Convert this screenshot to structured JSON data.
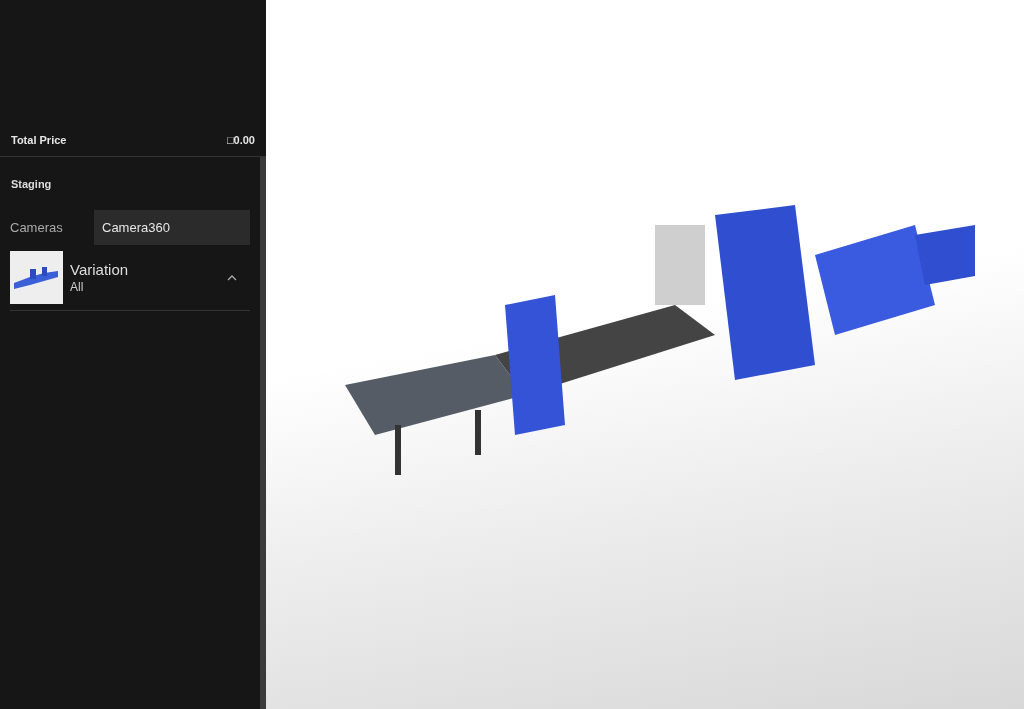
{
  "summary": {
    "label": "Total Price",
    "value": "□0.00"
  },
  "section": {
    "title": "Staging"
  },
  "cameras": {
    "label": "Cameras",
    "value": "Camera360"
  },
  "variation": {
    "title": "Variation",
    "value": "All",
    "expanded": true
  }
}
